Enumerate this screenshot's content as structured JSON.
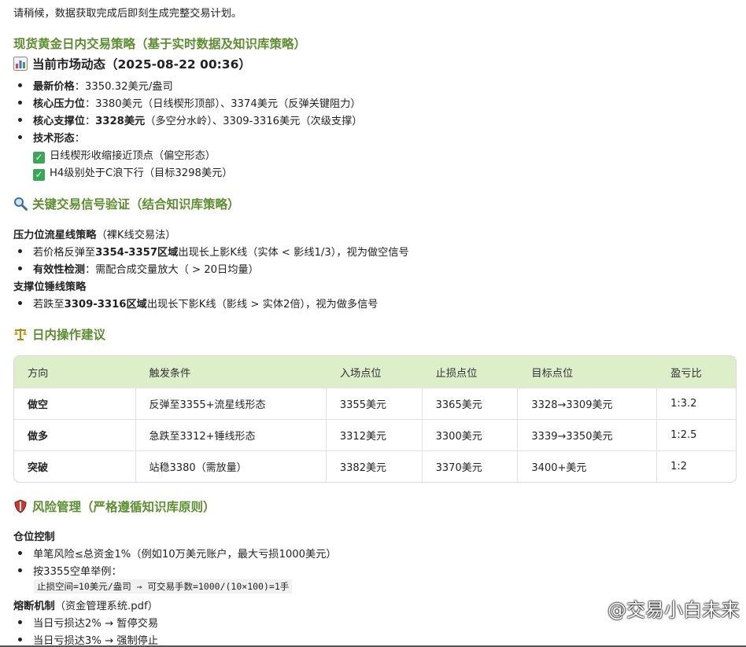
{
  "intro": "请稍候，数据获取完成后即刻生成完整交易计划。",
  "title": "现货黄金日内交易策略（基于实时数据及知识库策略）",
  "market": {
    "heading": "当前市场动态（2025-08-22 00:36）",
    "items": [
      {
        "label": "最新价格",
        "text": "：3350.32美元/盎司"
      },
      {
        "label": "核心压力位",
        "text": "：3380美元（日线楔形顶部）、3374美元（反弹关键阻力）"
      },
      {
        "label": "核心支撑位",
        "text": "：",
        "strong": "3328美元",
        "rest": "（多空分水岭）、3309-3316美元（次级支撑）"
      },
      {
        "label": "技术形态",
        "text": "："
      }
    ],
    "checks": [
      "日线楔形收缩接近顶点（偏空形态）",
      "H4级别处于C浪下行（目标3298美元）"
    ]
  },
  "signals": {
    "heading": "关键交易信号验证（结合知识库策略）",
    "sub1": {
      "label": "压力位流星线策略",
      "note": "（裸K线交易法）"
    },
    "sub1_items": [
      {
        "pre": "若价格反弹至",
        "strong": "3354-3357区域",
        "post": "出现长上影K线（实体 < 影线1/3），视为做空信号"
      },
      {
        "label": "有效性检测",
        "post": "：需配合成交量放大（ > 20日均量）"
      }
    ],
    "sub2": {
      "label": "支撑位锤线策略"
    },
    "sub2_items": [
      {
        "pre": "若跌至",
        "strong": "3309-3316区域",
        "post": "出现长下影K线（影线 > 实体2倍），视为做多信号"
      }
    ]
  },
  "ops": {
    "heading": "日内操作建议",
    "columns": [
      "方向",
      "触发条件",
      "入场点位",
      "止损点位",
      "目标点位",
      "盈亏比"
    ],
    "rows": [
      [
        "做空",
        "反弹至3355+流星线形态",
        "3355美元",
        "3365美元",
        "3328→3309美元",
        "1:3.2"
      ],
      [
        "做多",
        "急跌至3312+锤线形态",
        "3312美元",
        "3300美元",
        "3339→3350美元",
        "1:2.5"
      ],
      [
        "突破",
        "站稳3380（需放量）",
        "3382美元",
        "3370美元",
        "3400+美元",
        "1:2"
      ]
    ]
  },
  "risk": {
    "heading": "风险管理（严格遵循知识库原则）",
    "position": {
      "label": "仓位控制"
    },
    "position_items": [
      "单笔风险≤总资金1%（例如10万美元账户，最大亏损1000美元）",
      "按3355空单举例："
    ],
    "code": "止损空间=10美元/盎司 → 可交易手数=1000/(10×100)=1手",
    "breaker": {
      "label": "熔断机制",
      "note": "（资金管理系统.pdf）"
    },
    "breaker_items": [
      "当日亏损达2% → 暂停交易",
      "当日亏损达3% → 强制停止"
    ]
  },
  "watermark": "@交易小白未来"
}
